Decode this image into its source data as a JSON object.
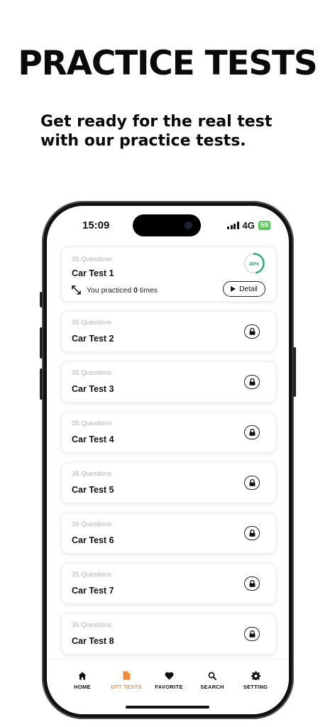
{
  "headline": "PRACTICE TESTS",
  "subline": "Get ready for the real test with our practice tests.",
  "status": {
    "time": "15:09",
    "network": "4G",
    "battery": "58"
  },
  "tests": [
    {
      "questions": "35 Questions",
      "title": "Car Test 1",
      "progress_label": "46%",
      "progress": 0.46,
      "practiced_prefix": "You practiced",
      "practiced_count": "0",
      "practiced_suffix": "times",
      "detail_label": "Detail",
      "locked": false
    },
    {
      "questions": "35 Questions",
      "title": "Car Test 2",
      "locked": true
    },
    {
      "questions": "35 Questions",
      "title": "Car Test 3",
      "locked": true
    },
    {
      "questions": "35 Questions",
      "title": "Car Test 4",
      "locked": true
    },
    {
      "questions": "35 Questions",
      "title": "Car Test 5",
      "locked": true
    },
    {
      "questions": "35 Questions",
      "title": "Car Test 6",
      "locked": true
    },
    {
      "questions": "35 Questions",
      "title": "Car Test 7",
      "locked": true
    },
    {
      "questions": "35 Questions",
      "title": "Car Test 8",
      "locked": true
    }
  ],
  "tabs": [
    {
      "label": "HOME",
      "icon": "home-icon"
    },
    {
      "label": "DTT TESTS",
      "icon": "document-icon",
      "active": true
    },
    {
      "label": "FAVORITE",
      "icon": "heart-icon"
    },
    {
      "label": "SEARCH",
      "icon": "search-icon"
    },
    {
      "label": "SETTING",
      "icon": "gear-icon"
    }
  ],
  "colors": {
    "accent": "#f08a3c",
    "progress": "#2bab84",
    "battery": "#5ac85a"
  }
}
